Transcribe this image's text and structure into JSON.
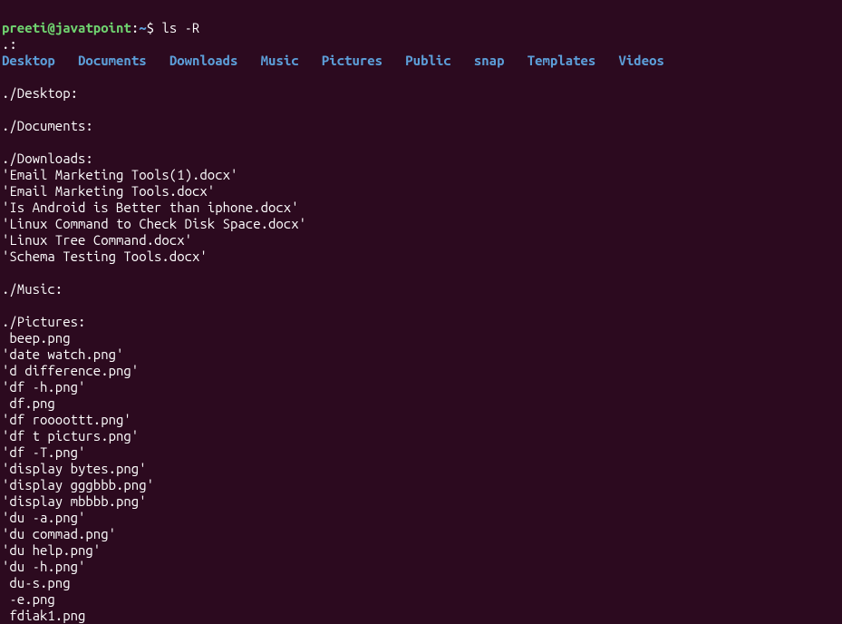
{
  "prompt": {
    "user": "preeti@javatpoint",
    "colon": ":",
    "path": "~",
    "dollar": "$",
    "command": " ls -R"
  },
  "sections": {
    "root_header": ".:",
    "root_dirs": [
      "Desktop",
      "Documents",
      "Downloads",
      "Music",
      "Pictures",
      "Public",
      "snap",
      "Templates",
      "Videos"
    ],
    "desktop_header": "./Desktop:",
    "documents_header": "./Documents:",
    "downloads_header": "./Downloads:",
    "downloads_files": [
      "'Email Marketing Tools(1).docx'",
      "'Email Marketing Tools.docx'",
      "'Is Android is Better than iphone.docx'",
      "'Linux Command to Check Disk Space.docx'",
      "'Linux Tree Command.docx'",
      "'Schema Testing Tools.docx'"
    ],
    "music_header": "./Music:",
    "pictures_header": "./Pictures:",
    "pictures_files": [
      " beep.png",
      "'date watch.png'",
      "'d difference.png'",
      "'df -h.png'",
      " df.png",
      "'df roooottt.png'",
      "'df t picturs.png'",
      "'df -T.png'",
      "'display bytes.png'",
      "'display gggbbb.png'",
      "'display mbbbb.png'",
      "'du -a.png'",
      "'du commad.png'",
      "'du help.png'",
      "'du -h.png'",
      " du-s.png",
      " -e.png",
      " fdiak1.png"
    ]
  }
}
